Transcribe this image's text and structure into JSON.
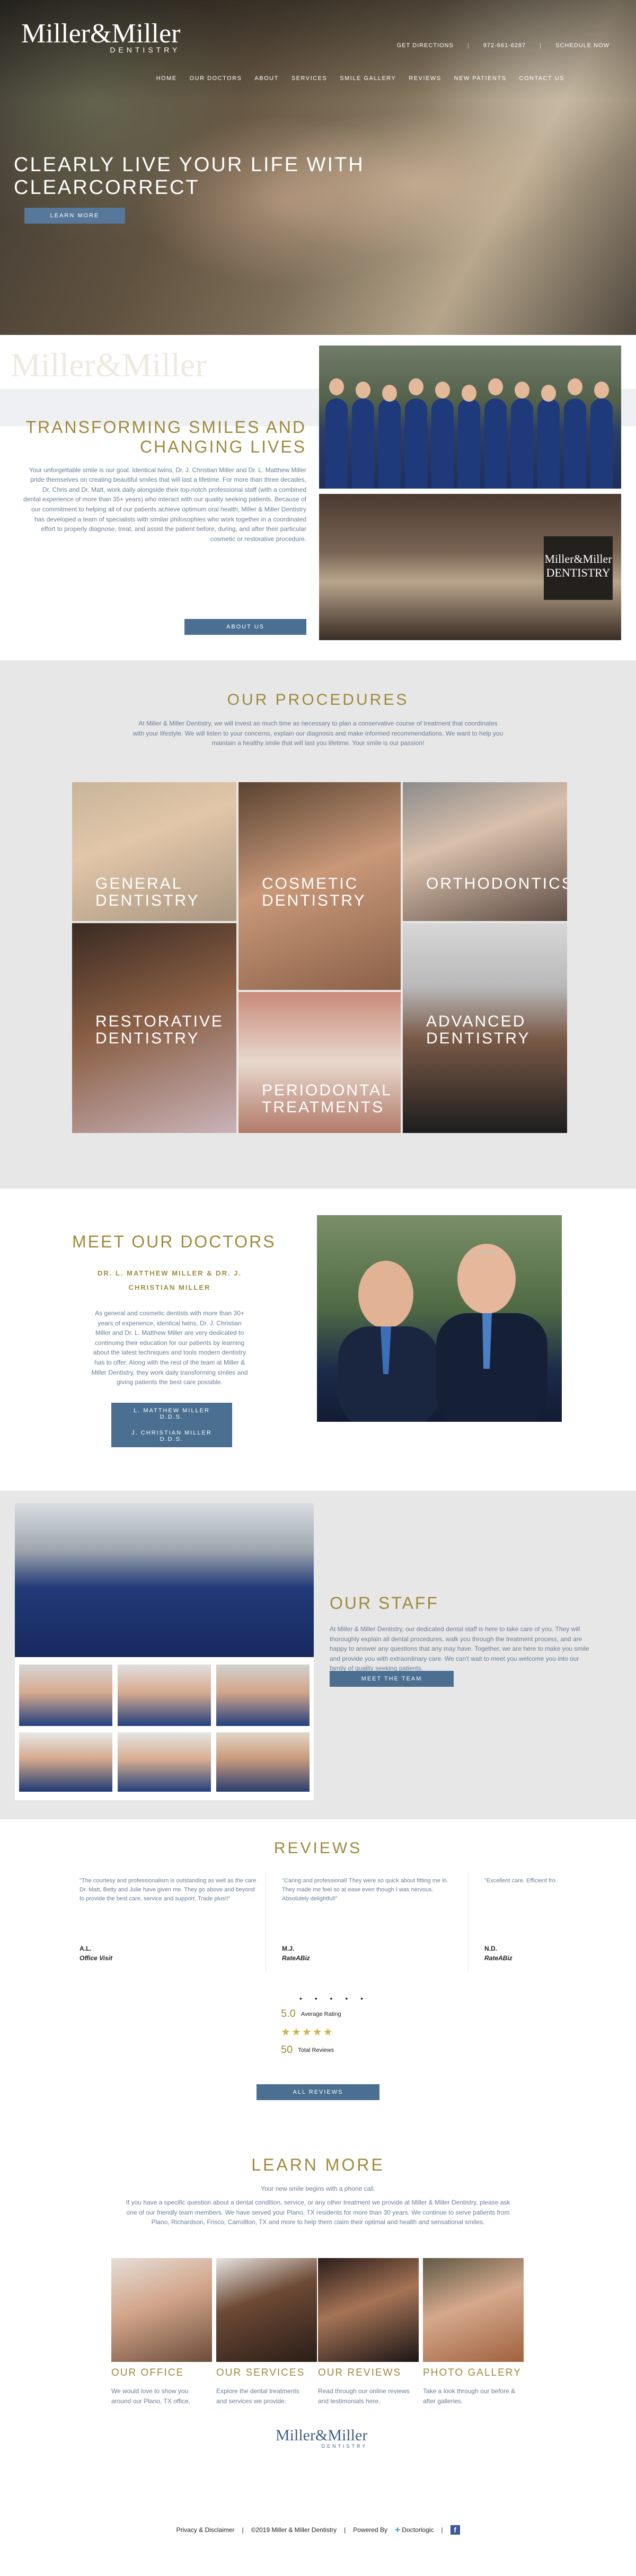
{
  "brand": {
    "name": "Miller&Miller",
    "sub": "DENTISTRY"
  },
  "topbar": {
    "directions": "GET DIRECTIONS",
    "phone": "972-661-6287",
    "schedule": "SCHEDULE NOW"
  },
  "nav": [
    "HOME",
    "OUR DOCTORS",
    "ABOUT",
    "SERVICES",
    "SMILE GALLERY",
    "REVIEWS",
    "NEW PATIENTS",
    "CONTACT US"
  ],
  "hero": {
    "title_line1": "CLEARLY LIVE YOUR LIFE WITH",
    "title_line2": "CLEARCORRECT",
    "button": "LEARN MORE"
  },
  "intro": {
    "watermark": "Miller&Miller",
    "title_line1": "TRANSFORMING SMILES AND",
    "title_line2": "CHANGING LIVES",
    "body": "Your unforgettable smile is our goal. Identical twins, Dr. J. Christian Miller and Dr. L. Matthew Miller pride themselves on creating beautiful smiles that will last a lifetime. For more than three decades, Dr. Chris and Dr. Matt, work daily alongside their top-notch professional staff (with a combined dental experience of more than 35+ years) who interact with our quality seeking patients. Because of our commitment to helping all of our patients achieve optimum oral health, Miller & Miller Dentistry has developed a team of specialists with similar philosophies who work together in a coordinated effort to properly diagnose, treat, and assist the patient before, during, and after their particular cosmetic or restorative procedure.",
    "button": "ABOUT US",
    "office_sign": "Miller&Miller DENTISTRY"
  },
  "procedures": {
    "title": "OUR PROCEDURES",
    "body": "At Miller & Miller Dentistry, we will invest as much time as necessary to plan a conservative course of treatment that coordinates with your lifestyle. We will listen to your concerns, explain our diagnosis and make informed recommendations. We want to help you maintain a healthy smile that will last you lifetime. Your smile is our passion!",
    "items": [
      {
        "line1": "GENERAL",
        "line2": "DENTISTRY"
      },
      {
        "line1": "COSMETIC",
        "line2": "DENTISTRY"
      },
      {
        "line1": "ORTHODONTICS",
        "line2": ""
      },
      {
        "line1": "RESTORATIVE",
        "line2": "DENTISTRY"
      },
      {
        "line1": "PERIODONTAL",
        "line2": "TREATMENTS"
      },
      {
        "line1": "ADVANCED",
        "line2": "DENTISTRY"
      }
    ]
  },
  "doctors": {
    "title": "MEET OUR DOCTORS",
    "subtitle": "DR. L. MATTHEW MILLER & DR. J. CHRISTIAN MILLER",
    "body": "As general and cosmetic dentists with more than 30+ years of experience, identical twins, Dr. J. Christian Miller and Dr. L. Matthew Miller are very dedicated to continuing their education for our patients by learning about the latest techniques and tools modern dentistry has to offer. Along with the rest of the team at Miller & Miller Dentistry, they work daily transforming smiles and giving patients the best care possible.",
    "button1": "L. MATTHEW MILLER D.D.S.",
    "button2": "J. CHRISTIAN MILLER D.D.S."
  },
  "staff": {
    "title": "OUR STAFF",
    "body": "At Miller & Miller Dentistry, our dedicated dental staff is here to take care of you. They will thoroughly explain all dental procedures, walk you through the treatment process, and are happy to answer any questions that any may have. Together, we are here to make you smile and provide you with extraordinary care. We can't wait to meet you welcome you into our family of quality seeking patients.",
    "button": "MEET THE TEAM"
  },
  "reviews": {
    "title": "REVIEWS",
    "items": [
      {
        "text": "\"The courtesy and professionalism is outstanding as well as the care Dr. Matt, Betty and Julie have given me. They go above and beyond to provide the best care, service and support. Trade plus!!\"",
        "name": "A.L.",
        "source": "Office Visit"
      },
      {
        "text": "\"Caring and professional! They were so quick about fitting me in. They made me feel so at ease even though I was nervous. Absolutely delightful!\"",
        "name": "M.J.",
        "source": "RateABiz"
      },
      {
        "text": "\"Excellent care. Efficient fro",
        "name": "N.D.",
        "source": "RateABiz"
      }
    ],
    "dots": "• • • • •",
    "average": "5.0",
    "average_label": "Average Rating",
    "stars": "★★★★★",
    "total": "50",
    "total_label": "Total Reviews",
    "button": "ALL REVIEWS"
  },
  "learn": {
    "title": "LEARN MORE",
    "lead": "Your new smile begins with a phone call.",
    "body": "If you have a specific question about a dental condition, service, or any other treatment we provide at Miller & Miller Dentistry, please ask one of our friendly team members. We have served your Plano, TX residents for more than 30 years. We continue to serve patients from Plano, Richardson, Frisco, Carrollton, TX and more to help them claim their optimal and health and sensational smiles.",
    "cards": [
      {
        "title": "OUR OFFICE",
        "text": "We would love to show you around our Plano, TX office."
      },
      {
        "title": "OUR SERVICES",
        "text": "Explore the dental treatments and services we provide."
      },
      {
        "title": "OUR REVIEWS",
        "text": "Read through our online reviews and testimonials here."
      },
      {
        "title": "PHOTO GALLERY",
        "text": "Take a look through our before & after galleries."
      }
    ]
  },
  "footer": {
    "privacy": "Privacy & Disclaimer",
    "copyright": "©2019 Miller & Miller Dentistry",
    "powered": "Powered By",
    "vendor": "Doctorlogic",
    "fb": "f"
  },
  "colors": {
    "gold": "#a08a3c",
    "button": "#4a6f91",
    "gray_band": "#e7e7e7"
  }
}
